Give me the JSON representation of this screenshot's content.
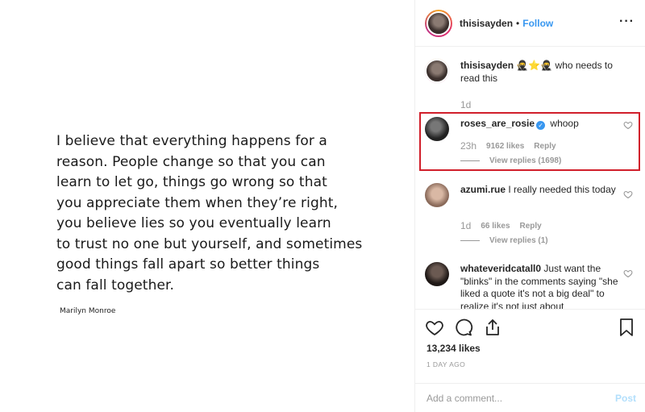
{
  "post": {
    "quote": "I believe that everything happens for a\nreason. People change so that you can\nlearn to let go, things go wrong so that\nyou appreciate them when they’re right,\nyou believe lies so you eventually learn\nto trust no one but yourself, and sometimes\ngood things fall apart so better things\ncan fall together.",
    "author": "Marilyn Monroe"
  },
  "header": {
    "username": "thisisayden",
    "separator": "•",
    "follow_label": "Follow",
    "more_label": "···"
  },
  "caption": {
    "username": "thisisayden",
    "text": "🥷⭐🥷 who needs to read this",
    "time": "1d"
  },
  "comments": [
    {
      "username": "roses_are_rosie",
      "verified": true,
      "text": "whoop",
      "time": "23h",
      "likes": "9162 likes",
      "reply": "Reply",
      "view_replies": "View replies (1698)"
    },
    {
      "username": "azumi.rue",
      "text": "I really needed this today",
      "time": "1d",
      "likes": "66 likes",
      "reply": "Reply",
      "view_replies": "View replies (1)"
    },
    {
      "username": "whateveridcatall0",
      "text": "Just want the \"blinks\" in the comments saying \"she liked a quote it's not a big deal\" to realize it's not just about"
    }
  ],
  "actions": {
    "likes": "13,234 likes",
    "time_ago": "1 DAY AGO",
    "comment_placeholder": "Add a comment...",
    "post_label": "Post"
  },
  "colors": {
    "link_blue": "#3897f0",
    "highlight_red": "#d11f2b",
    "muted": "#999999"
  }
}
